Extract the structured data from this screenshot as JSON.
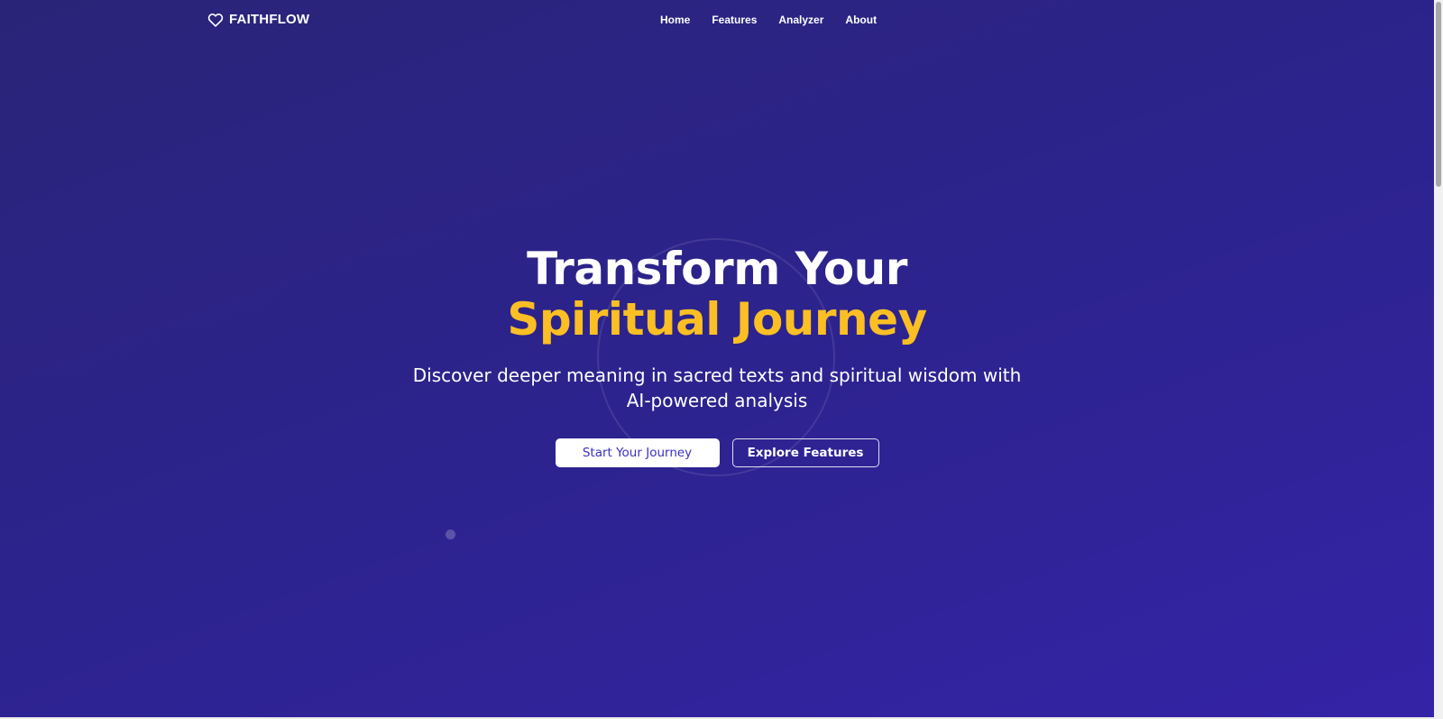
{
  "brand": {
    "name": "FAITHFLOW",
    "icon": "heart-icon"
  },
  "nav": {
    "items": [
      {
        "label": "Home"
      },
      {
        "label": "Features"
      },
      {
        "label": "Analyzer"
      },
      {
        "label": "About"
      }
    ]
  },
  "hero": {
    "title_line1": "Transform Your",
    "title_line2": "Spiritual Journey",
    "subtitle": "Discover deeper meaning in sacred texts and spiritual wisdom with AI-powered analysis",
    "primary_cta": "Start Your Journey",
    "secondary_cta": "Explore Features"
  },
  "colors": {
    "background_start": "#2a2478",
    "background_end": "#3423a6",
    "accent": "#fbbf24",
    "primary_button_text": "#3b2fc4"
  }
}
